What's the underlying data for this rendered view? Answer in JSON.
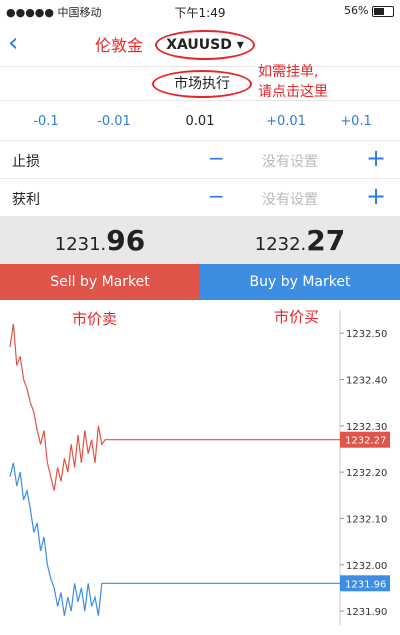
{
  "status": {
    "carrier": "●●●●● 中国移动",
    "time": "下午1:49",
    "battery": "56%",
    "battery_level": 0.56
  },
  "nav": {
    "annotation_gold": "伦敦金",
    "symbol": "XAUUSD ▾"
  },
  "mode": {
    "label": "市场执行",
    "annotation_line1": "如需挂单,",
    "annotation_line2": "请点击这里"
  },
  "steps": [
    "-0.1",
    "-0.01",
    "0.01",
    "+0.01",
    "+0.1"
  ],
  "stop_loss": {
    "label": "止损",
    "value": "没有设置"
  },
  "take_profit": {
    "label": "获利",
    "value": "没有设置"
  },
  "prices": {
    "sell_main": "1231.",
    "sell_big": "96",
    "buy_main": "1232.",
    "buy_big": "27"
  },
  "buttons": {
    "sell": "Sell by Market",
    "buy": "Buy by Market"
  },
  "annotations": {
    "sell": "市价卖",
    "buy": "市价买"
  },
  "chart_data": {
    "type": "line",
    "y_ticks": [
      "1232.50",
      "1232.40",
      "1232.30",
      "1232.20",
      "1232.10",
      "1232.00",
      "1231.90"
    ],
    "ylim": [
      1231.87,
      1232.55
    ],
    "series": [
      {
        "color": "#e0544a",
        "current": "1232.27",
        "current_value": 1232.27,
        "values": [
          1232.47,
          1232.52,
          1232.43,
          1232.45,
          1232.4,
          1232.38,
          1232.35,
          1232.33,
          1232.29,
          1232.26,
          1232.29,
          1232.22,
          1232.19,
          1232.16,
          1232.21,
          1232.18,
          1232.23,
          1232.2,
          1232.26,
          1232.21,
          1232.28,
          1232.22,
          1232.29,
          1232.24,
          1232.27,
          1232.22,
          1232.3,
          1232.26,
          1232.27
        ]
      },
      {
        "color": "#3d8de3",
        "current": "1231.96",
        "current_value": 1231.96,
        "values": [
          1232.19,
          1232.22,
          1232.17,
          1232.2,
          1232.14,
          1232.16,
          1232.12,
          1232.07,
          1232.09,
          1232.03,
          1232.06,
          1232.0,
          1231.97,
          1231.95,
          1231.91,
          1231.94,
          1231.89,
          1231.93,
          1231.9,
          1231.96,
          1231.92,
          1231.95,
          1231.9,
          1231.96,
          1231.91,
          1231.93,
          1231.89,
          1231.96,
          1231.96
        ]
      }
    ]
  }
}
